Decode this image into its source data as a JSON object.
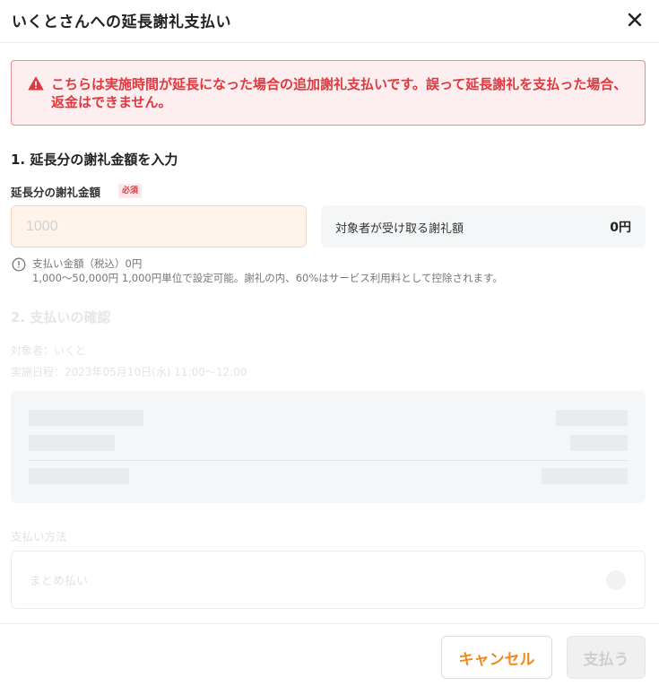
{
  "header": {
    "title": "いくとさんへの延長謝礼支払い",
    "close_icon": "close-icon"
  },
  "alert": {
    "icon": "warning-icon",
    "text": "こちらは実施時間が延長になった場合の追加謝礼支払いです。誤って延長謝礼を支払った場合、返金はできません。",
    "color": "#e2373e"
  },
  "section1": {
    "title": "1. 延長分の謝礼金額を入力",
    "field_label": "延長分の謝礼金額",
    "required_badge": "必須",
    "amount_placeholder": "1000",
    "amount_value": "",
    "receive_label": "対象者が受け取る謝礼額",
    "receive_value": "0円",
    "info_icon": "info-icon",
    "info_line1": "支払い金額（税込）0円",
    "info_line2": "1,000〜50,000円 1,000円単位で設定可能。謝礼の内、60%はサービス利用料として控除されます。"
  },
  "section2": {
    "title": "2. 支払いの確認",
    "target": "対象者：いくと",
    "date": "実施日程：2023年05月10日(水) 11:00〜12:00"
  },
  "payment_method": {
    "label": "支払い方法",
    "value": "まとめ払い"
  },
  "footer": {
    "cancel_label": "キャンセル",
    "pay_label": "支払う",
    "accent_color": "#f08a1e"
  }
}
